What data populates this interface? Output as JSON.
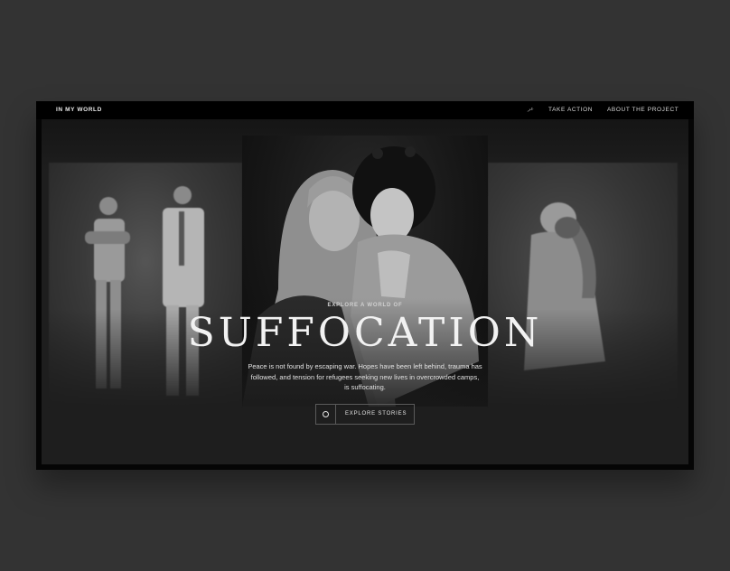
{
  "header": {
    "brand": "IN MY WORLD",
    "lang": "عر",
    "nav": {
      "take_action": "TAKE ACTION",
      "about": "ABOUT THE PROJECT"
    }
  },
  "hero": {
    "kicker": "EXPLORE A WORLD OF",
    "title": "SUFFOCATION",
    "description": "Peace is not found by escaping war. Hopes have been left behind, trauma has followed, and tension for refugees seeking new lives in overcrowded camps, is suffocating.",
    "cta_label": "EXPLORE STORIES"
  },
  "colors": {
    "background": "#333333",
    "stage": "#1e1e1e",
    "text": "#f2f2f2"
  },
  "icons": {
    "cta": "circle-icon"
  }
}
